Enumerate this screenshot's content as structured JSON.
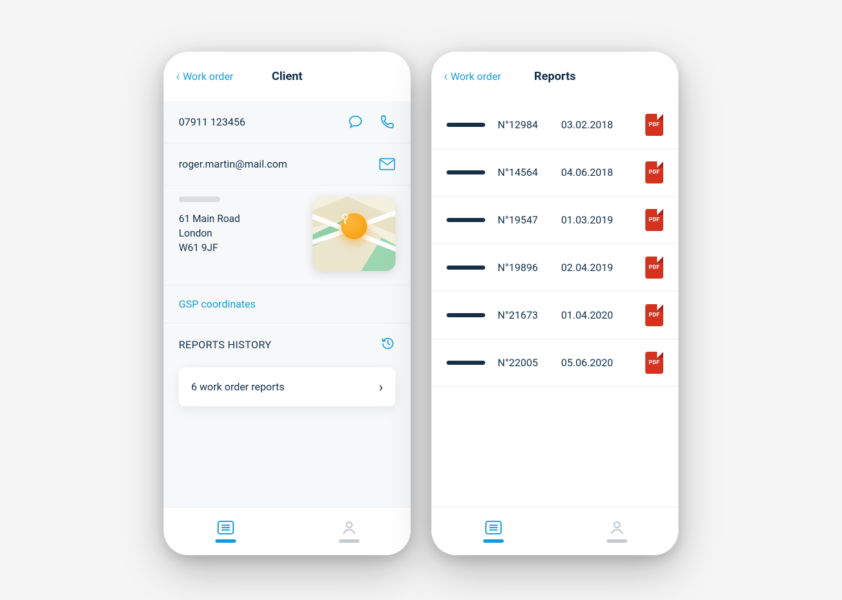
{
  "client": {
    "back_label": "Work order",
    "title": "Client",
    "phone": "07911 123456",
    "email": "roger.martin@mail.com",
    "address_line1": "61 Main Road",
    "address_line2": "London",
    "address_line3": "W61 9JF",
    "gps_label": "GSP coordinates",
    "section_label": "REPORTS HISTORY",
    "reports_card": "6 work order reports"
  },
  "reports": {
    "back_label": "Work order",
    "title": "Reports",
    "pdf_label": "PDF",
    "items": [
      {
        "number": "N°12984",
        "date": "03.02.2018"
      },
      {
        "number": "N°14564",
        "date": "04.06.2018"
      },
      {
        "number": "N°19547",
        "date": "01.03.2019"
      },
      {
        "number": "N°19896",
        "date": "02.04.2019"
      },
      {
        "number": "N°21673",
        "date": "01.04.2020"
      },
      {
        "number": "N°22005",
        "date": "05.06.2020"
      }
    ]
  },
  "colors": {
    "accent": "#129bdb",
    "text": "#0f2e4a",
    "pdf": "#d4321f"
  }
}
